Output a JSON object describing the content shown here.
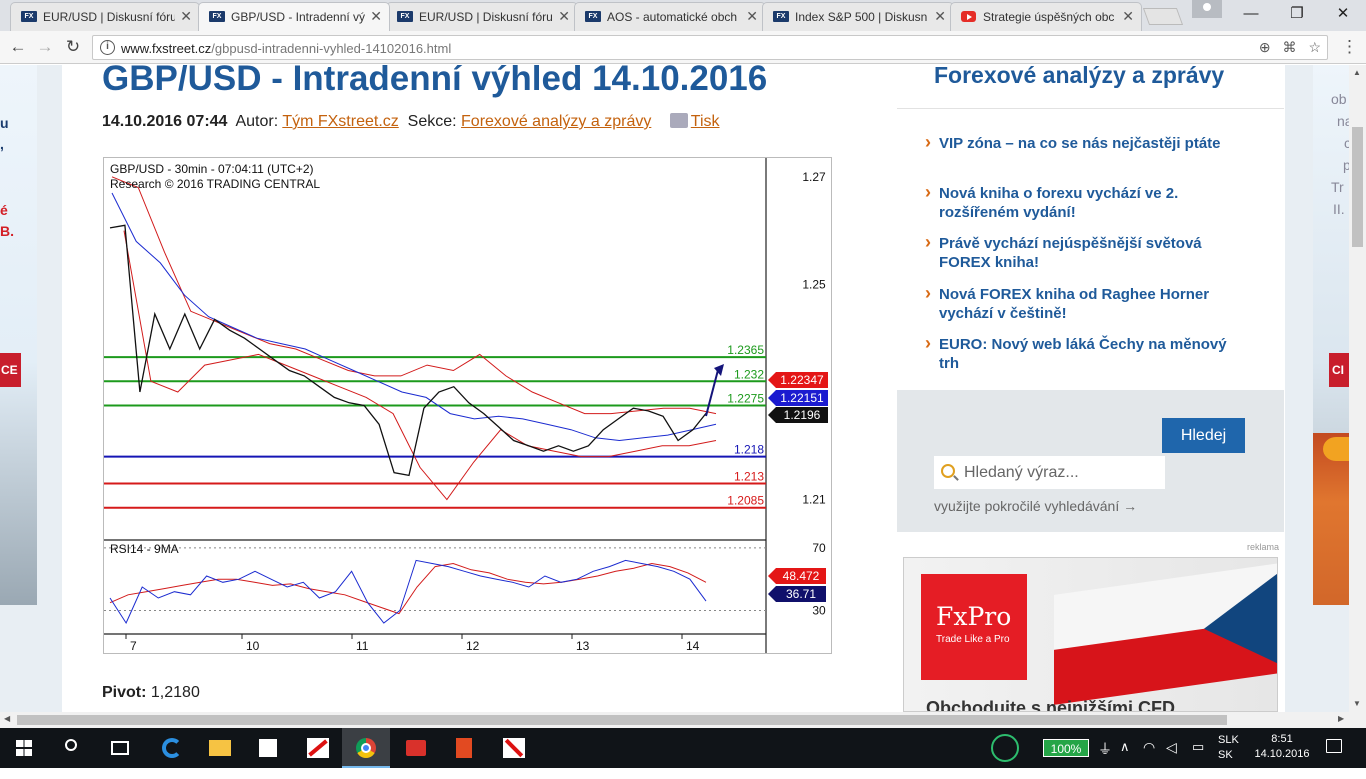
{
  "browser": {
    "tabs": [
      {
        "title": "EUR/USD | Diskusní fóru",
        "favicon": "fxstreet-icon",
        "active": false
      },
      {
        "title": "GBP/USD - Intradenní vý",
        "favicon": "fxstreet-icon",
        "active": true
      },
      {
        "title": "EUR/USD | Diskusní fóru",
        "favicon": "fxstreet-icon",
        "active": false
      },
      {
        "title": "AOS - automatické obch",
        "favicon": "fxstreet-icon",
        "active": false
      },
      {
        "title": "Index S&P 500 | Diskusn",
        "favicon": "fxstreet-icon",
        "active": false
      },
      {
        "title": "Strategie úspěšných obc",
        "favicon": "youtube-icon",
        "active": false
      }
    ],
    "favicon_text": "FX",
    "url_host": "www.fxstreet.cz",
    "url_path": "/gbpusd-intradenni-vyhled-14102016.html",
    "window_controls": {
      "minimize": "—",
      "maximize": "❐",
      "close": "✕"
    }
  },
  "left_ad": {
    "lines": [
      "u",
      ",",
      "é",
      "B."
    ],
    "button": "CE"
  },
  "right_ad": {
    "lines": [
      "ob",
      "na",
      "c",
      "p",
      "Tr",
      "II."
    ],
    "button": "CI"
  },
  "article": {
    "title": "GBP/USD - Intradenní výhled 14.10.2016",
    "date": "14.10.2016 07:44",
    "author_label": "Autor:",
    "author": "Tým FXstreet.cz",
    "section_label": "Sekce:",
    "section": "Forexové analýzy a zprávy",
    "print_label": "Tisk",
    "pivot_label": "Pivot:",
    "pivot_value": "1,2180"
  },
  "chart_data": {
    "type": "line",
    "title": "GBP/USD - 30min - 07:04:11 (UTC+2)",
    "subtitle": "Research © 2016 TRADING CENTRAL",
    "x_ticks": [
      "7",
      "10",
      "11",
      "12",
      "13",
      "14"
    ],
    "y_ticks": [
      "1.27",
      "1.25",
      "1.21"
    ],
    "ylim": [
      1.2025,
      1.2735
    ],
    "price_path": [
      1.2605,
      1.261,
      1.23,
      1.2445,
      1.238,
      1.2445,
      1.238,
      1.2435,
      1.2415,
      1.24,
      1.238,
      1.236,
      1.234,
      1.233,
      1.231,
      1.229,
      1.228,
      1.2275,
      1.224,
      1.215,
      1.2145,
      1.227,
      1.23,
      1.231,
      1.228,
      1.226,
      1.2235,
      1.221,
      1.22,
      1.219,
      1.22,
      1.219,
      1.22,
      1.223,
      1.225,
      1.227,
      1.2265,
      1.2255,
      1.221,
      1.223,
      1.2265
    ],
    "moving_average": [
      1.267,
      1.258,
      1.254,
      1.248,
      1.244,
      1.242,
      1.24,
      1.239,
      1.238,
      1.236,
      1.234,
      1.232,
      1.23,
      1.229,
      1.226,
      1.225,
      1.2255,
      1.225,
      1.224,
      1.223,
      1.2215,
      1.221,
      1.2215,
      1.222,
      1.223,
      1.224
    ],
    "bollinger_upper": [
      1.27,
      1.268,
      1.256,
      1.245,
      1.243,
      1.241,
      1.239,
      1.238,
      1.236,
      1.234,
      1.233,
      1.233,
      1.235,
      1.234,
      1.237,
      1.233,
      1.23,
      1.228,
      1.226,
      1.226,
      1.2265,
      1.227,
      1.227,
      1.226
    ],
    "bollinger_lower": [
      1.26,
      1.232,
      1.23,
      1.235,
      1.236,
      1.237,
      1.235,
      1.233,
      1.231,
      1.229,
      1.226,
      1.216,
      1.21,
      1.217,
      1.223,
      1.22,
      1.219,
      1.218,
      1.218,
      1.219,
      1.22,
      1.22,
      1.221
    ],
    "levels": [
      {
        "value": 1.2365,
        "label": "1.2365",
        "color": "#1c9a1c"
      },
      {
        "value": 1.232,
        "label": "1.232",
        "color": "#1c9a1c"
      },
      {
        "value": 1.2275,
        "label": "1.2275",
        "color": "#1c9a1c"
      },
      {
        "value": 1.218,
        "label": "1.218",
        "color": "#1515b5"
      },
      {
        "value": 1.213,
        "label": "1.213",
        "color": "#d61a1a"
      },
      {
        "value": 1.2085,
        "label": "1.2085",
        "color": "#d61a1a"
      }
    ],
    "price_tags": [
      {
        "label": "1.22347",
        "bg": "#e41616"
      },
      {
        "label": "1.22151",
        "bg": "#1b1bd0"
      },
      {
        "label": "1.2196",
        "bg": "#111111"
      }
    ],
    "rsi": {
      "label": "RSI14 - 9MA",
      "y_ticks": [
        "70",
        "30"
      ],
      "ylim": [
        15,
        75
      ],
      "tags": [
        {
          "label": "48.472",
          "bg": "#e41616"
        },
        {
          "label": "36.71",
          "bg": "#10106b"
        }
      ],
      "rsi_path": [
        38,
        22,
        45,
        38,
        42,
        40,
        52,
        48,
        50,
        55,
        50,
        45,
        48,
        38,
        42,
        55,
        35,
        22,
        30,
        62,
        60,
        58,
        55,
        52,
        50,
        48,
        45,
        52,
        48,
        50,
        55,
        58,
        62,
        60,
        58,
        55,
        50,
        36
      ],
      "ma_path": [
        35,
        40,
        42,
        44,
        46,
        48,
        50,
        50,
        48,
        46,
        47,
        44,
        42,
        40,
        36,
        32,
        28,
        45,
        58,
        60,
        56,
        54,
        50,
        48,
        47,
        48,
        50,
        52,
        55,
        57,
        60,
        58,
        54,
        48
      ]
    }
  },
  "sidebar": {
    "title": "Forexové analýzy a zprávy",
    "items": [
      "VIP zóna – na co se nás nejčastěji ptáte",
      "Nová kniha o forexu vychází ve 2. rozšířeném vydání!",
      "Právě vychází nejúspěšnější světová FOREX kniha!",
      "Nová FOREX kniha od Raghee Horner vychází v češtině!",
      "EURO: Nový web láká Čechy na měnový trh"
    ],
    "search_button": "Hledej",
    "search_placeholder": "Hledaný výraz...",
    "advanced_search": "využijte pokročilé vyhledávání →",
    "ad_label": "reklama",
    "ad": {
      "brand": "FxPro",
      "tagline": "Trade Like a Pro",
      "bottom_text": "Obchodujte s nejnižšími CFD"
    }
  },
  "taskbar": {
    "battery": "100%",
    "lang_1": "SLK",
    "lang_2": "SK",
    "time": "8:51",
    "date": "14.10.2016"
  }
}
